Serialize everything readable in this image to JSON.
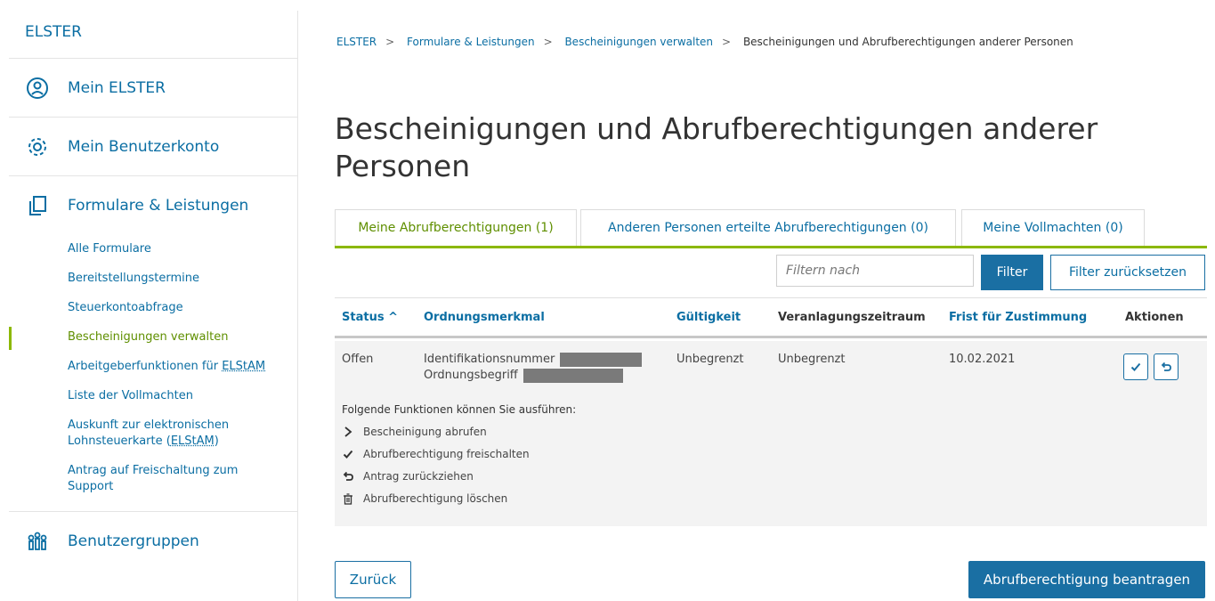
{
  "sidebar": {
    "top_label": "ELSTER",
    "mein_elster": "Mein ELSTER",
    "benutzerkonto": "Mein Benutzerkonto",
    "formulare": "Formulare & Leistungen",
    "items": [
      {
        "label": "Alle Formulare"
      },
      {
        "label": "Bereitstellungstermine"
      },
      {
        "label": "Steuerkontoabfrage"
      },
      {
        "label": "Bescheinigungen verwalten"
      },
      {
        "label_prefix": "Arbeitgeberfunktionen für",
        "label_abbr": "ELStAM"
      },
      {
        "label": "Liste der Vollmachten"
      },
      {
        "label_line1": "Auskunft zur elektronischen",
        "label_line2_prefix": "Lohnsteuerkarte (",
        "label_abbr": "ELStAM",
        "label_line2_suffix": ")"
      },
      {
        "label_line1": "Antrag auf Freischaltung zum",
        "label_line2": "Support"
      }
    ],
    "benutzergruppen": "Benutzergruppen"
  },
  "breadcrumb": [
    "ELSTER",
    "Formulare & Leistungen",
    "Bescheinigungen verwalten",
    "Bescheinigungen und Abrufberechtigungen anderer Personen"
  ],
  "title": "Bescheinigungen und Abrufberechtigungen anderer Personen",
  "tabs": [
    {
      "label": "Meine Abrufberechtigungen (1)",
      "active": true
    },
    {
      "label": "Anderen Personen erteilte Abrufberechtigungen (0)",
      "active": false
    },
    {
      "label": "Meine Vollmachten (0)",
      "active": false
    }
  ],
  "filter": {
    "placeholder": "Filtern nach",
    "button": "Filter",
    "reset": "Filter zurücksetzen"
  },
  "table": {
    "columns": [
      "Status ^",
      "Ordnungsmerkmal",
      "Gültigkeit",
      "Veranlagungszeitraum",
      "Frist für Zustimmung",
      "Aktionen"
    ],
    "row": {
      "status": "Offen",
      "ordnung_line1": "Identifikationsnummer",
      "ordnung_line2": "Ordnungsbegriff",
      "gueltigkeit": "Unbegrenzt",
      "zeitraum": "Unbegrenzt",
      "frist": "10.02.2021"
    },
    "functions_title": "Folgende Funktionen können Sie ausführen:",
    "functions": [
      {
        "icon": "chevron-right-icon",
        "label": "Bescheinigung abrufen"
      },
      {
        "icon": "check-icon",
        "label": "Abrufberechtigung freischalten"
      },
      {
        "icon": "undo-icon",
        "label": "Antrag zurückziehen"
      },
      {
        "icon": "trash-icon",
        "label": "Abrufberechtigung löschen"
      }
    ]
  },
  "buttons": {
    "back": "Zurück",
    "request": "Abrufberechtigung beantragen"
  },
  "colors": {
    "link_blue": "#0b6ea3",
    "button_blue": "#1a6fa3",
    "active_green": "#8cb800",
    "row_bg": "#f3f3f3"
  }
}
